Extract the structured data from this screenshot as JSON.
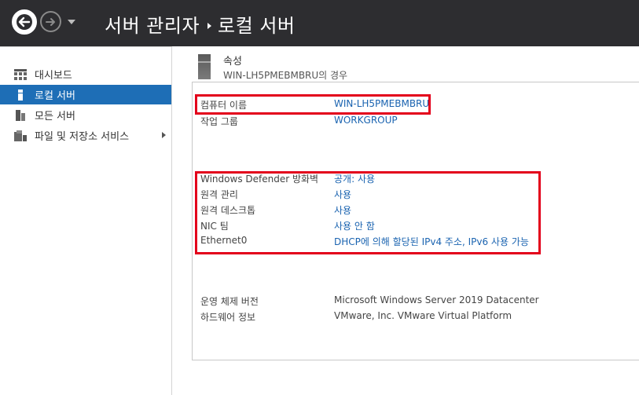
{
  "title": {
    "app": "서버 관리자",
    "page": "로컬 서버"
  },
  "sidebar": {
    "items": [
      {
        "label": "대시보드",
        "icon": "dashboard-icon"
      },
      {
        "label": "로컬 서버",
        "icon": "local-server-icon"
      },
      {
        "label": "모든 서버",
        "icon": "all-servers-icon"
      },
      {
        "label": "파일 및 저장소 서비스",
        "icon": "file-storage-icon"
      }
    ]
  },
  "properties": {
    "title": "속성",
    "subtitle": "WIN-LH5PMEBMBRU의 경우",
    "rows": [
      {
        "label": "컴퓨터 이름",
        "value": "WIN-LH5PMEBMBRU"
      },
      {
        "label": "작업 그룹",
        "value": "WORKGROUP"
      },
      {
        "label": "Windows Defender 방화벽",
        "value": "공개: 사용"
      },
      {
        "label": "원격 관리",
        "value": "사용"
      },
      {
        "label": "원격 데스크톱",
        "value": "사용"
      },
      {
        "label": "NIC 팀",
        "value": "사용 안 함"
      },
      {
        "label": "Ethernet0",
        "value": "DHCP에 의해 할당된 IPv4 주소, IPv6 사용 가능"
      },
      {
        "label": "운영 체제 버전",
        "value": "Microsoft Windows Server 2019 Datacenter"
      },
      {
        "label": "하드웨어 정보",
        "value": "VMware, Inc. VMware Virtual Platform"
      }
    ]
  },
  "colors": {
    "titlebar": "#2d2d30",
    "accent": "#1e6eb6",
    "link": "#1a63b0",
    "highlight": "#e3001b"
  }
}
